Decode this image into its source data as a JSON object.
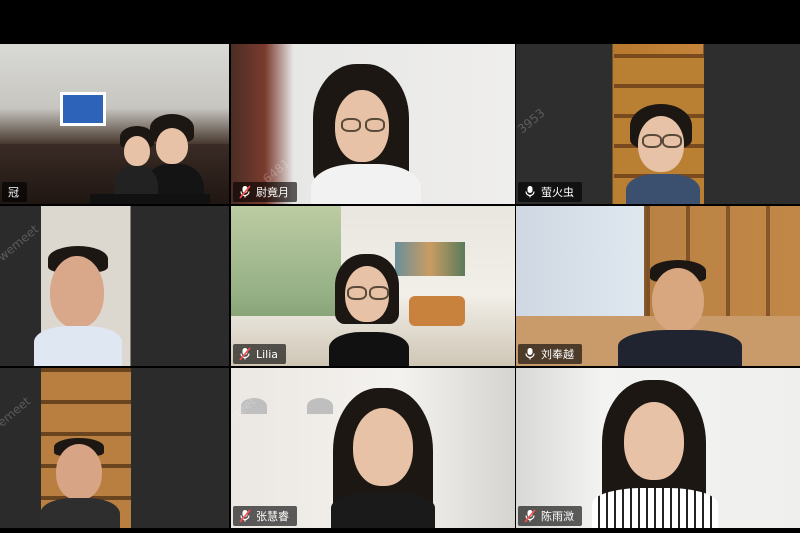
{
  "meeting": {
    "app_watermark": "wemeet",
    "watermark_ids": [
      "3953",
      "6481",
      "3953",
      "8481"
    ],
    "participants": [
      {
        "id": "p1",
        "name": "冠",
        "active": true,
        "mic": "none"
      },
      {
        "id": "p2",
        "name": "尉竟月",
        "mic": "muted"
      },
      {
        "id": "p3",
        "name": "萤火虫",
        "mic": "on"
      },
      {
        "id": "p4",
        "name": "",
        "mic": "none"
      },
      {
        "id": "p5",
        "name": "Lilia",
        "mic": "muted"
      },
      {
        "id": "p6",
        "name": "刘奉越",
        "mic": "on"
      },
      {
        "id": "p7",
        "name": "",
        "mic": "none"
      },
      {
        "id": "p8",
        "name": "张慧睿",
        "mic": "muted"
      },
      {
        "id": "p9",
        "name": "陈雨溦",
        "mic": "muted"
      }
    ]
  },
  "colors": {
    "active_border": "#22c55e",
    "nameplate_bg": "#000000",
    "muted_icon": "#ff4d4f",
    "on_icon": "#ffffff"
  }
}
